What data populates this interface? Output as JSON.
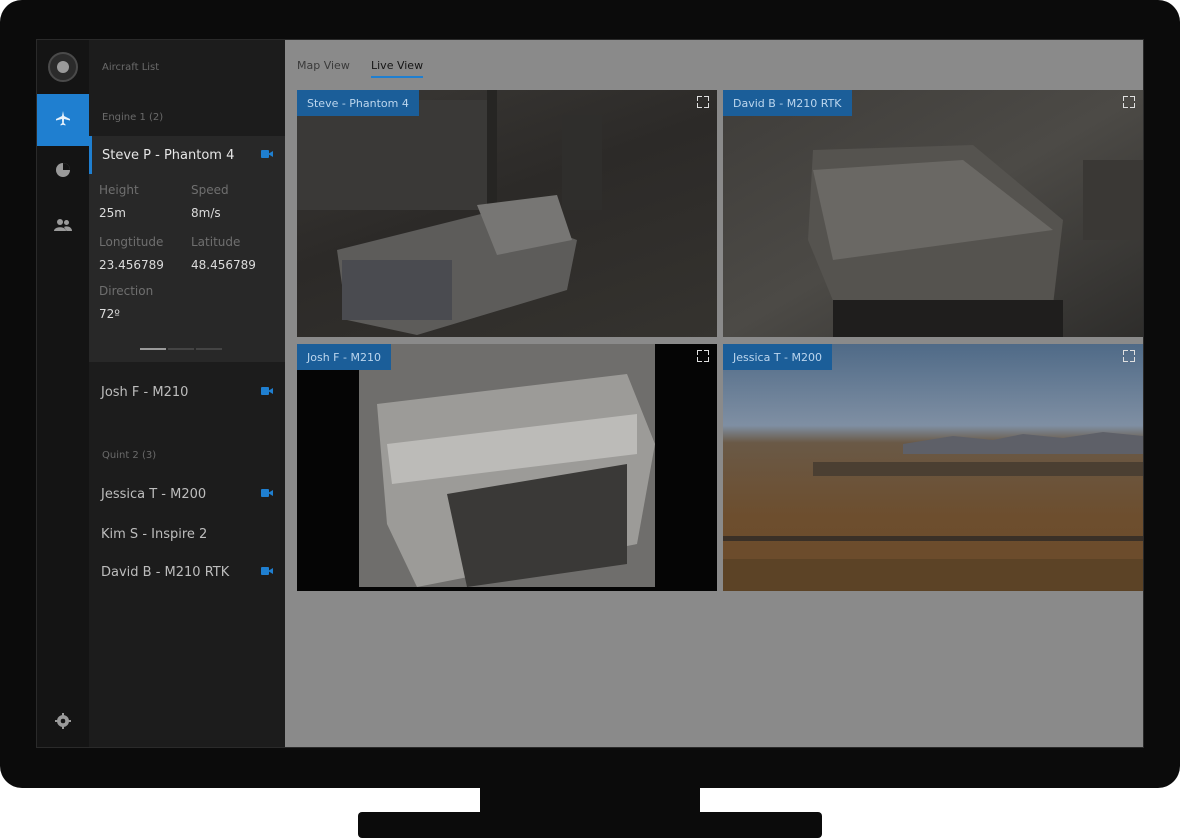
{
  "sidebar": {
    "icons": [
      "logo-icon",
      "airplane-icon",
      "pie-chart-icon",
      "users-icon",
      "gear-icon"
    ]
  },
  "panel": {
    "title": "Aircraft List",
    "groups": [
      {
        "label": "Engine 1 (2)"
      },
      {
        "label": "Quint 2 (3)"
      }
    ],
    "aircraft": [
      {
        "name": "Steve P - Phantom 4",
        "camera": true,
        "active": true
      },
      {
        "name": "Josh F - M210",
        "camera": true
      },
      {
        "name": "Jessica T - M200",
        "camera": true
      },
      {
        "name": "Kim S - Inspire 2",
        "camera": false
      },
      {
        "name": "David B - M210 RTK",
        "camera": true
      }
    ],
    "details": {
      "height_label": "Height",
      "height_value": "25m",
      "speed_label": "Speed",
      "speed_value": "8m/s",
      "longitude_label": "Longtitude",
      "longitude_value": "23.456789",
      "latitude_label": "Latitude",
      "latitude_value": "48.456789",
      "direction_label": "Direction",
      "direction_value": "72º"
    }
  },
  "main": {
    "tabs": [
      {
        "label": "Map View",
        "active": false
      },
      {
        "label": "Live View",
        "active": true
      }
    ],
    "feeds": [
      {
        "label": "Steve - Phantom 4"
      },
      {
        "label": "David B - M210 RTK"
      },
      {
        "label": "Josh F - M210"
      },
      {
        "label": "Jessica T - M200"
      }
    ]
  },
  "colors": {
    "accent": "#1f7fd0",
    "rail": "#141414",
    "panel": "#1c1c1c"
  }
}
